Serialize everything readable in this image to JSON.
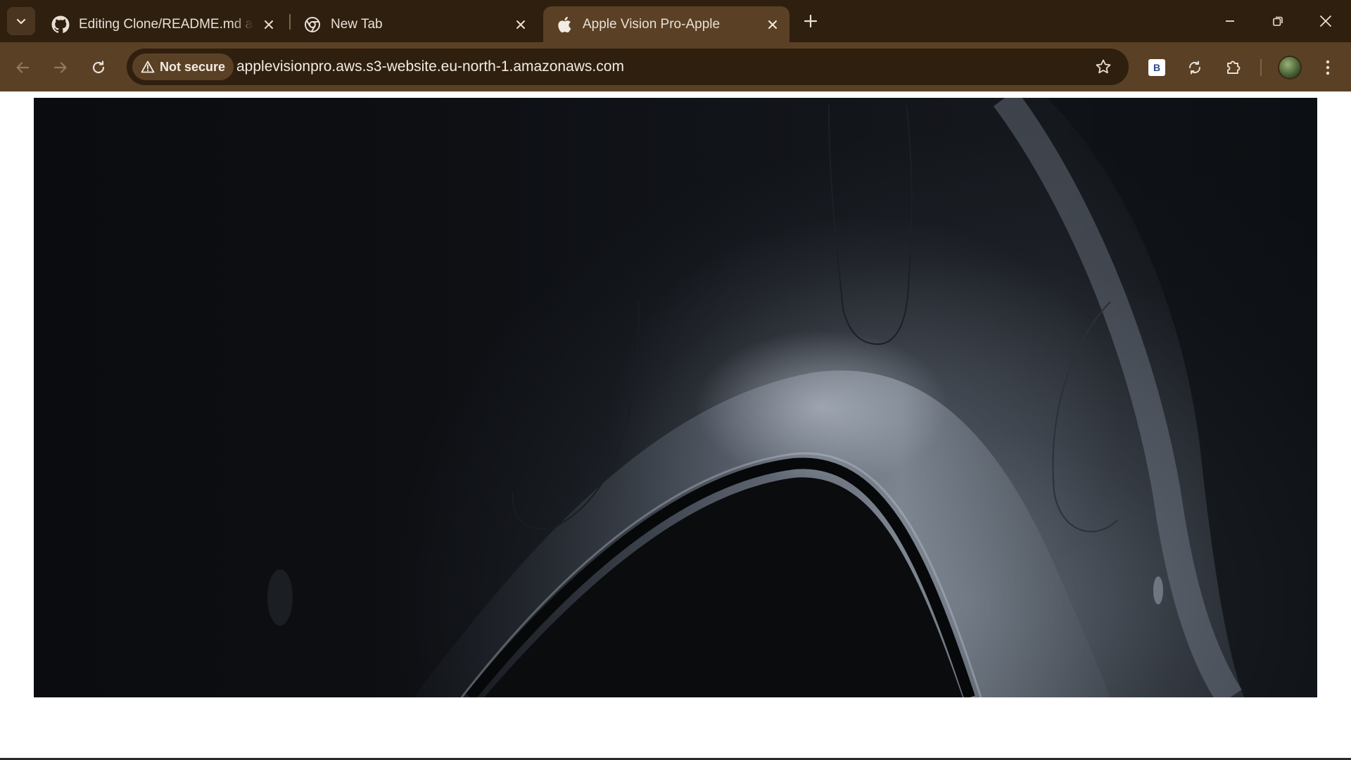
{
  "browser": {
    "tabs": [
      {
        "title": "Editing Clone/README.md at main",
        "favicon": "github-icon",
        "active": false
      },
      {
        "title": "New Tab",
        "favicon": "chrome-icon",
        "active": false
      },
      {
        "title": "Apple Vision Pro-Apple",
        "favicon": "apple-icon",
        "active": true
      }
    ],
    "address_bar": {
      "security_label": "Not secure",
      "url": "applevisionpro.aws.s3-website.eu-north-1.amazonaws.com"
    },
    "extension_badge": "B"
  },
  "page": {
    "hero_image": "apple-vision-pro-headset-closeup"
  },
  "colors": {
    "tabstrip": "#2f1f0e",
    "toolbar": "#5a4025",
    "omnibox": "#2f1f0e",
    "page_background": "#ffffff"
  }
}
